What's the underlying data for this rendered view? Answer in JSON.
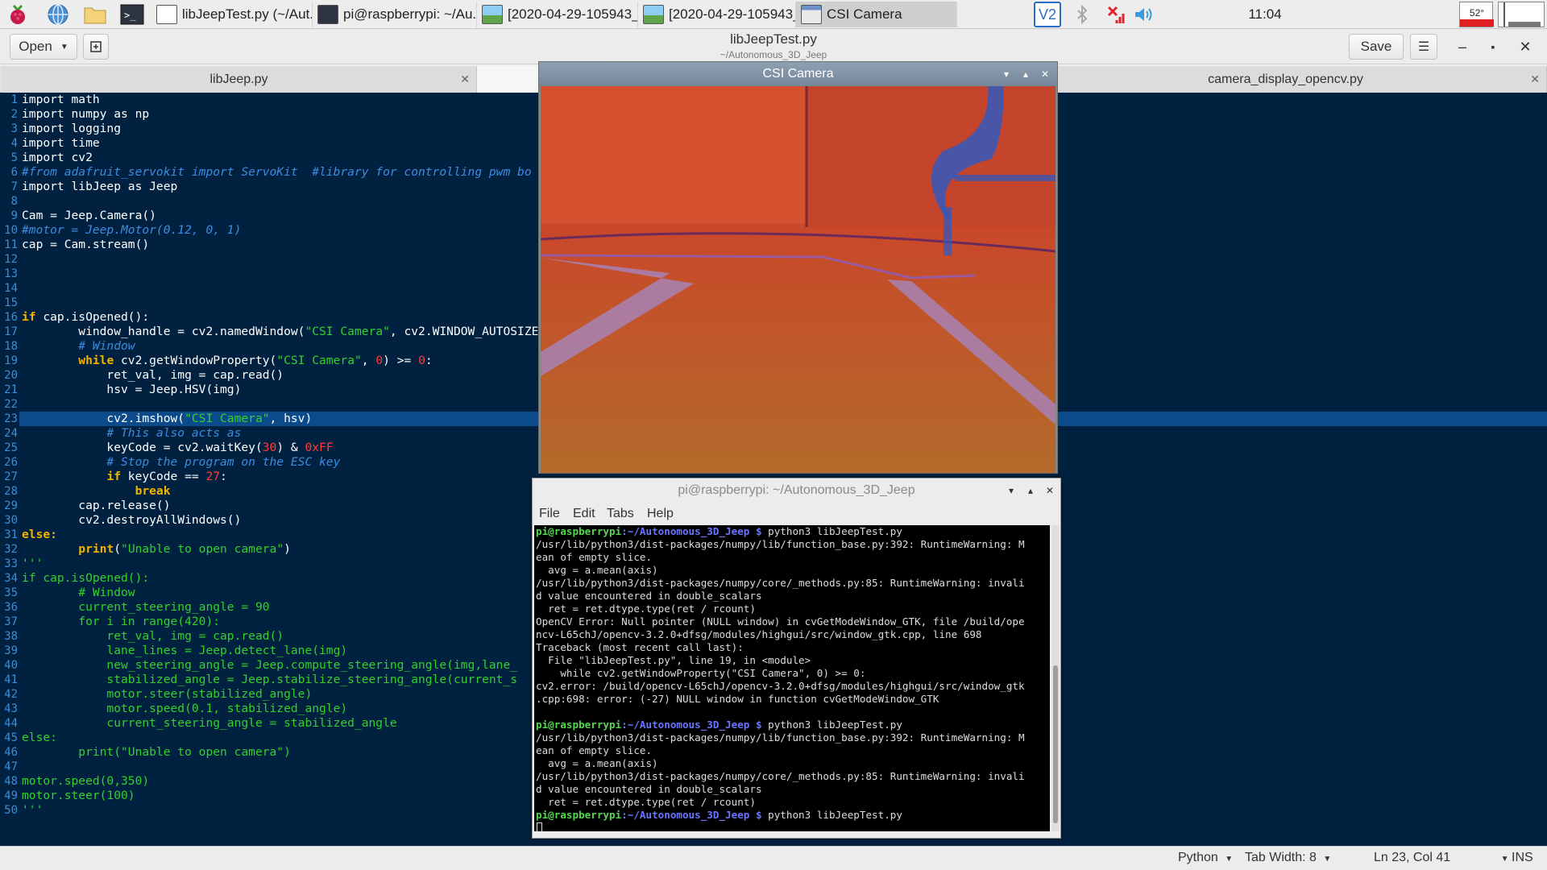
{
  "taskbar": {
    "tasks": [
      {
        "label": "libJeepTest.py (~/Aut..."
      },
      {
        "label": "pi@raspberrypi: ~/Au..."
      },
      {
        "label": "[2020-04-29-105943_..."
      },
      {
        "label": "[2020-04-29-105943_..."
      },
      {
        "label": "CSI Camera"
      }
    ],
    "clock": "11:04",
    "cpu_temp": "52°",
    "vnc_label": "V2"
  },
  "editor_header": {
    "open_label": "Open",
    "title": "libJeepTest.py",
    "subtitle": "~/Autonomous_3D_Jeep",
    "save_label": "Save"
  },
  "tabs": [
    {
      "label": "libJeep.py"
    },
    {
      "label": "camera_display_opencv.py"
    }
  ],
  "code": {
    "line_numbers": [
      "1",
      "2",
      "3",
      "4",
      "5",
      "6",
      "7",
      "8",
      "9",
      "10",
      "11",
      "12",
      "13",
      "14",
      "15",
      "16",
      "17",
      "18",
      "19",
      "20",
      "21",
      "22",
      "23",
      "24",
      "25",
      "26",
      "27",
      "28",
      "29",
      "30",
      "31",
      "32",
      "33",
      "34",
      "35",
      "36",
      "37",
      "38",
      "39",
      "40",
      "41",
      "42",
      "43",
      "44",
      "45",
      "46",
      "47",
      "48",
      "49",
      "50"
    ],
    "lines": {
      "l1": "import math",
      "l2": "import numpy as np",
      "l3": "import logging",
      "l4": "import time",
      "l5": "import cv2",
      "l6": "#from adafruit_servokit import ServoKit  #library for controlling pwm bo",
      "l7": "import libJeep as Jeep",
      "l9": "Cam = Jeep.Camera()",
      "l10": "#motor = Jeep.Motor(0.12, 0, 1)",
      "l11": "cap = Cam.stream()",
      "l16a": "if",
      "l16b": " cap.isOpened():",
      "l17a": "        window_handle = cv2.namedWindow(",
      "l17b": "\"CSI Camera\"",
      "l17c": ", cv2.WINDOW_AUTOSIZE",
      "l18": "        # Window",
      "l19a": "        ",
      "l19b": "while",
      "l19c": " cv2.getWindowProperty(",
      "l19d": "\"CSI Camera\"",
      "l19e": ", ",
      "l19f": "0",
      "l19g": ") >= ",
      "l19h": "0",
      "l19i": ":",
      "l20": "            ret_val, img = cap.read()",
      "l21": "            hsv = Jeep.HSV(img)",
      "l23a": "            cv2.imshow(",
      "l23b": "\"CSI Camera\"",
      "l23c": ", hsv)",
      "l24": "            # This also acts as",
      "l25a": "            keyCode = cv2.waitKey(",
      "l25b": "30",
      "l25c": ") & ",
      "l25d": "0xFF",
      "l26": "            # Stop the program on the ESC key",
      "l27a": "            ",
      "l27b": "if",
      "l27c": " keyCode == ",
      "l27d": "27",
      "l27e": ":",
      "l28": "                break",
      "l29": "        cap.release()",
      "l30": "        cv2.destroyAllWindows()",
      "l31": "else:",
      "l32a": "        ",
      "l32b": "print",
      "l32c": "(",
      "l32d": "\"Unable to open camera\"",
      "l32e": ")",
      "l33": "'''",
      "l34": "if cap.isOpened():",
      "l35": "        # Window",
      "l36": "        current_steering_angle = 90",
      "l37": "        for i in range(420):",
      "l38": "            ret_val, img = cap.read()",
      "l39": "            lane_lines = Jeep.detect_lane(img)",
      "l40": "            new_steering_angle = Jeep.compute_steering_angle(img,lane_",
      "l41": "            stabilized_angle = Jeep.stabilize_steering_angle(current_s",
      "l42": "            motor.steer(stabilized_angle)",
      "l43": "            motor.speed(0.1, stabilized_angle)",
      "l44": "            current_steering_angle = stabilized_angle",
      "l45": "else:",
      "l46": "        print(\"Unable to open camera\")",
      "l48": "motor.speed(0,350)",
      "l49": "motor.steer(100)",
      "l50": "'''"
    }
  },
  "statusbar": {
    "language": "Python",
    "tab_width": "Tab Width: 8",
    "position": "Ln 23, Col 41",
    "mode": "INS"
  },
  "camera_window": {
    "title": "CSI Camera"
  },
  "terminal": {
    "title": "pi@raspberrypi: ~/Autonomous_3D_Jeep",
    "menu": [
      "File",
      "Edit",
      "Tabs",
      "Help"
    ],
    "prompt_user": "pi@raspberrypi",
    "prompt_path": ":~/Autonomous_3D_Jeep $",
    "command": " python3 libJeepTest.py",
    "out1": [
      "/usr/lib/python3/dist-packages/numpy/lib/function_base.py:392: RuntimeWarning: M",
      "ean of empty slice.",
      "  avg = a.mean(axis)",
      "/usr/lib/python3/dist-packages/numpy/core/_methods.py:85: RuntimeWarning: invali",
      "d value encountered in double_scalars",
      "  ret = ret.dtype.type(ret / rcount)",
      "OpenCV Error: Null pointer (NULL window) in cvGetModeWindow_GTK, file /build/ope",
      "ncv-L65chJ/opencv-3.2.0+dfsg/modules/highgui/src/window_gtk.cpp, line 698",
      "Traceback (most recent call last):",
      "  File \"libJeepTest.py\", line 19, in <module>",
      "    while cv2.getWindowProperty(\"CSI Camera\", 0) >= 0:",
      "cv2.error: /build/opencv-L65chJ/opencv-3.2.0+dfsg/modules/highgui/src/window_gtk",
      ".cpp:698: error: (-27) NULL window in function cvGetModeWindow_GTK"
    ],
    "out2": [
      "/usr/lib/python3/dist-packages/numpy/lib/function_base.py:392: RuntimeWarning: M",
      "ean of empty slice.",
      "  avg = a.mean(axis)",
      "/usr/lib/python3/dist-packages/numpy/core/_methods.py:85: RuntimeWarning: invali",
      "d value encountered in double_scalars",
      "  ret = ret.dtype.type(ret / rcount)"
    ]
  }
}
